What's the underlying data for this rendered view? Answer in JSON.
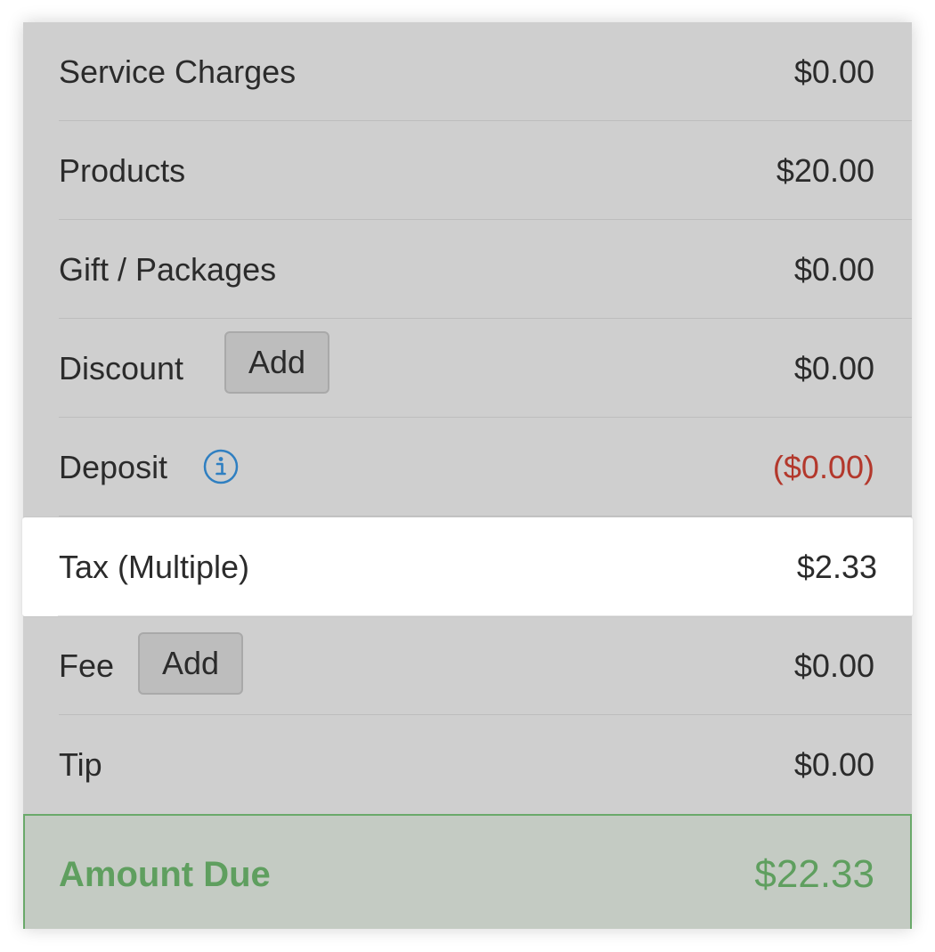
{
  "rows": {
    "service_charges": {
      "label": "Service Charges",
      "value": "$0.00"
    },
    "products": {
      "label": "Products",
      "value": "$20.00"
    },
    "gift_packages": {
      "label": "Gift / Packages",
      "value": "$0.00"
    },
    "discount": {
      "label": "Discount",
      "button": "Add",
      "value": "$0.00"
    },
    "deposit": {
      "label": "Deposit",
      "icon": "info-icon",
      "value": "($0.00)"
    },
    "tax": {
      "label": "Tax (Multiple)",
      "value": "$2.33"
    },
    "fee": {
      "label": "Fee",
      "button": "Add",
      "value": "$0.00"
    },
    "tip": {
      "label": "Tip",
      "value": "$0.00"
    }
  },
  "amount_due": {
    "label": "Amount Due",
    "value": "$22.33"
  },
  "colors": {
    "panel_bg": "#cfcfcf",
    "highlight_bg": "#ffffff",
    "negative": "#b3382c",
    "accent_green": "#5f9f5f",
    "info_blue": "#2f7fc1"
  }
}
